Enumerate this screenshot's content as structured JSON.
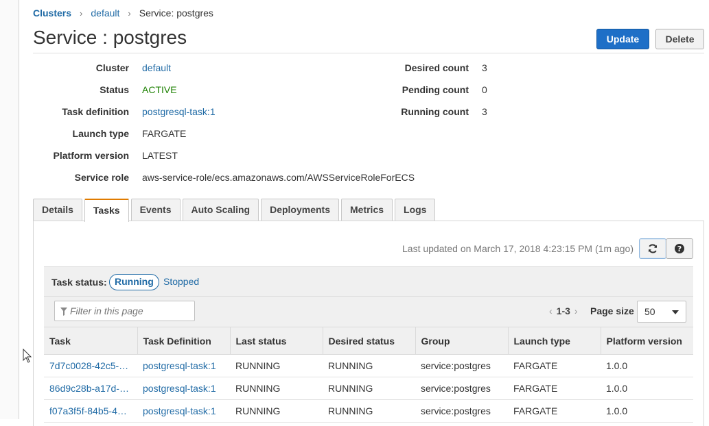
{
  "breadcrumb": {
    "root": "Clusters",
    "cluster": "default",
    "current": "Service: postgres",
    "separator": "›"
  },
  "page": {
    "title": "Service : postgres"
  },
  "actions": {
    "update_label": "Update",
    "delete_label": "Delete"
  },
  "details": {
    "left": [
      {
        "label": "Cluster",
        "value": "default"
      },
      {
        "label": "Status",
        "value": "ACTIVE"
      },
      {
        "label": "Task definition",
        "value": "postgresql-task:1"
      },
      {
        "label": "Launch type",
        "value": "FARGATE"
      },
      {
        "label": "Platform version",
        "value": "LATEST"
      },
      {
        "label": "Service role",
        "value": "aws-service-role/ecs.amazonaws.com/AWSServiceRoleForECS"
      }
    ],
    "right": [
      {
        "label": "Desired count",
        "value": "3"
      },
      {
        "label": "Pending count",
        "value": "0"
      },
      {
        "label": "Running count",
        "value": "3"
      }
    ]
  },
  "tabs": [
    "Details",
    "Tasks",
    "Events",
    "Auto Scaling",
    "Deployments",
    "Metrics",
    "Logs"
  ],
  "active_tab": "Tasks",
  "tasks_panel": {
    "last_updated": "Last updated on March 17, 2018 4:23:15 PM (1m ago)",
    "task_status_label": "Task status:",
    "status_running": "Running",
    "status_stopped": "Stopped",
    "filter_placeholder": "Filter in this page",
    "pager_range": "1-3",
    "page_size_label": "Page size",
    "page_size_value": "50",
    "columns": [
      "Task",
      "Task Definition",
      "Last status",
      "Desired status",
      "Group",
      "Launch type",
      "Platform version"
    ],
    "rows": [
      [
        "7d7c0028-42c5-…",
        "postgresql-task:1",
        "RUNNING",
        "RUNNING",
        "service:postgres",
        "FARGATE",
        "1.0.0"
      ],
      [
        "86d9c28b-a17d-…",
        "postgresql-task:1",
        "RUNNING",
        "RUNNING",
        "service:postgres",
        "FARGATE",
        "1.0.0"
      ],
      [
        "f07a3f5f-84b5-4…",
        "postgresql-task:1",
        "RUNNING",
        "RUNNING",
        "service:postgres",
        "FARGATE",
        "1.0.0"
      ]
    ]
  },
  "colors": {
    "link": "#1f6aa5",
    "active_green": "#1d8102",
    "primary_button": "#1e6fc7",
    "tab_accent": "#e07b00"
  },
  "icons": {
    "refresh": "refresh-icon",
    "help": "help-icon",
    "filter": "filter-icon"
  }
}
